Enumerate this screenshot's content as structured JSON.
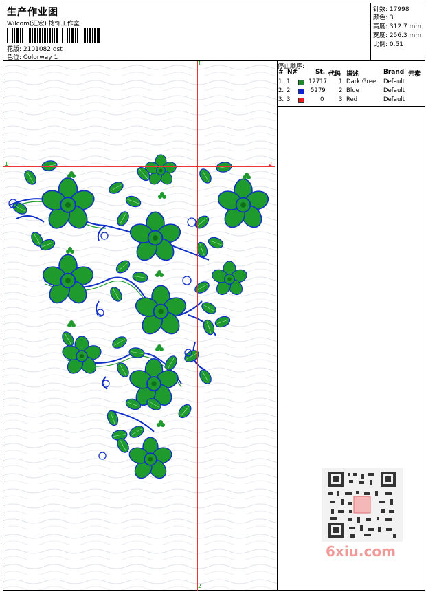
{
  "header": {
    "title": "生产作业图",
    "studio": "Wilcom(汇宏) 捻饰工作室",
    "design_label": "花版:",
    "design_value": "2101082.dst",
    "colorway_label": "色位:",
    "colorway_value": "Colorway 1"
  },
  "stats": [
    {
      "label": "针数:",
      "value": "17998"
    },
    {
      "label": "颜色:",
      "value": "3"
    },
    {
      "label": "高度:",
      "value": "312.7 mm"
    },
    {
      "label": "宽度:",
      "value": "256.3 mm"
    },
    {
      "label": "比例:",
      "value": "0.51"
    }
  ],
  "stop_sequence": {
    "title": "停止顺序:",
    "columns": [
      "#",
      "N#",
      "St.",
      "代码",
      "描述",
      "Brand",
      "元素"
    ],
    "rows": [
      {
        "seq": "1.",
        "n": "1",
        "color": "#1a8a2a",
        "stitches": "12717",
        "code": "1",
        "desc": "Dark Green",
        "brand": "Default"
      },
      {
        "seq": "2.",
        "n": "2",
        "color": "#0a22d8",
        "stitches": "5279",
        "code": "2",
        "desc": "Blue",
        "brand": "Default"
      },
      {
        "seq": "3.",
        "n": "3",
        "color": "#e81c1c",
        "stitches": "0",
        "code": "3",
        "desc": "Red",
        "brand": "Default"
      }
    ]
  },
  "guides": {
    "top": "1",
    "bottom": "2",
    "left": "1",
    "right": "2"
  },
  "colors": {
    "leaf": "#1f9a2c",
    "outline": "#1030c8",
    "guide": "#e33333",
    "background_wave": "#d8dde8"
  },
  "watermark": "6xiu.com"
}
